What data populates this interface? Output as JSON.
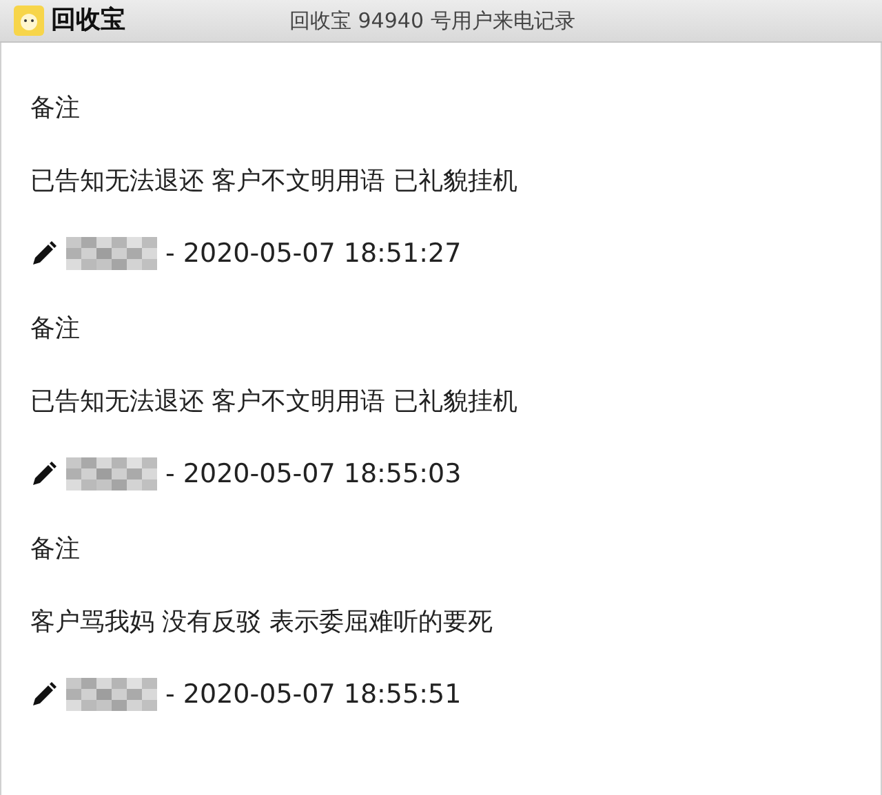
{
  "app": {
    "logo_text": "回收宝"
  },
  "window": {
    "title": "回收宝 94940 号用户来电记录"
  },
  "notes": [
    {
      "label": "备注",
      "text": "已告知无法退还 客户不文明用语 已礼貌挂机",
      "timestamp": "- 2020-05-07 18:51:27"
    },
    {
      "label": "备注",
      "text": "已告知无法退还 客户不文明用语 已礼貌挂机",
      "timestamp": "- 2020-05-07 18:55:03"
    },
    {
      "label": "备注",
      "text": "客户骂我妈 没有反驳 表示委屈难听的要死",
      "timestamp": "- 2020-05-07 18:55:51"
    }
  ]
}
